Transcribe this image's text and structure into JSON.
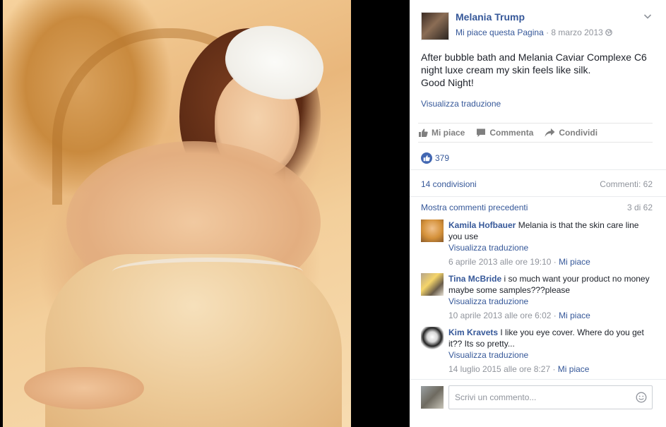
{
  "post": {
    "author": "Melania Trump",
    "like_page": "Mi piace questa Pagina",
    "separator": " · ",
    "date": "8 marzo 2013",
    "text_line1": "After bubble bath and Melania Caviar Complexe C6",
    "text_line2": "night luxe cream my skin feels like silk.",
    "text_line3": "Good Night!",
    "translate": "Visualizza traduzione"
  },
  "actions": {
    "like": "Mi piace",
    "comment": "Commenta",
    "share": "Condividi"
  },
  "stats": {
    "likes": "379",
    "shares": "14 condivisioni",
    "comments": "Commenti: 62"
  },
  "comments_section": {
    "show_previous": "Mostra commenti precedenti",
    "counter": "3 di 62",
    "items": [
      {
        "name": "Kamila Hofbauer",
        "text": "Melania is that the skin care line you use",
        "translate": "Visualizza traduzione",
        "time": "6 aprile 2013 alle ore 19:10",
        "like": "Mi piace"
      },
      {
        "name": "Tina McBride",
        "text": "i so much want your product no money maybe some samples???please",
        "translate": "Visualizza traduzione",
        "time": "10 aprile 2013 alle ore 6:02",
        "like": "Mi piace"
      },
      {
        "name": "Kim Kravets",
        "text": "I like you eye cover. Where do you get it?? Its so pretty...",
        "translate": "Visualizza traduzione",
        "time": "14 luglio 2015 alle ore 8:27",
        "like": "Mi piace"
      }
    ]
  },
  "composer": {
    "placeholder": "Scrivi un commento..."
  },
  "colors": {
    "link": "#365899",
    "muted": "#90949c",
    "like_blue": "#4267b2"
  }
}
